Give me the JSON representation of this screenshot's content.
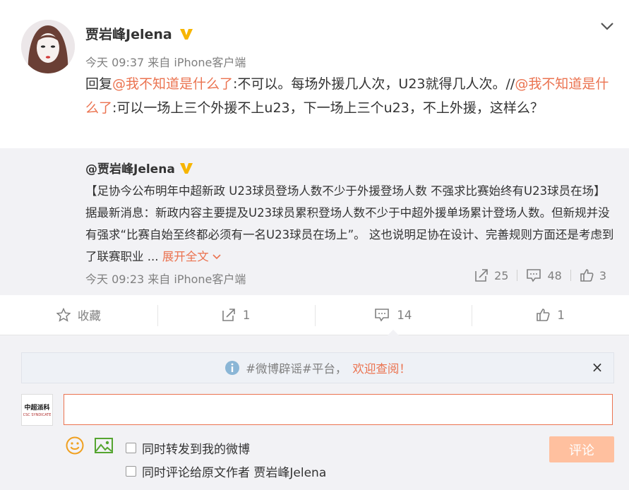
{
  "post": {
    "author": "贾岩峰Jelena",
    "meta": "今天 09:37 来自 iPhone客户端",
    "text": {
      "p1": "回复",
      "m1": "@我不知道是什么了",
      "p2": ":不可以。每场外援几人次，U23就得几人次。//",
      "m2": "@我不知道是什么了",
      "p3": ":可以一场上三个外援不上u23，下一场上三个u23，不上外援，这样么？"
    }
  },
  "repost": {
    "author": "@贾岩峰Jelena",
    "text": "【足协今公布明年中超新政 U23球员登场人数不少于外援登场人数 不强求比赛始终有U23球员在场】据最新消息：新政内容主要提及U23球员累积登场人数不少于中超外援单场累计登场人数。但新规并没有强求“比赛自始至终都必须有一名U23球员在场上”。 这也说明足协在设计、完善规则方面还是考虑到了联赛职业 ...",
    "more": "展开全文",
    "meta": "今天 09:23 来自 iPhone客户端",
    "forwards": "25",
    "comments": "48",
    "likes": "3"
  },
  "actions": {
    "favorite": "收藏",
    "forward": "1",
    "comment": "14",
    "like": "1"
  },
  "notice": {
    "text": "#微博辟谣#平台，",
    "link": "欢迎查阅！",
    "close": "×"
  },
  "logo": {
    "main": "中超派科",
    "sub": "CSC  SYNDICATE"
  },
  "comment": {
    "value": "",
    "option1": "同时转发到我的微博",
    "option2": "同时评论给原文作者 贾岩峰Jelena",
    "submit": "评论"
  },
  "colors": {
    "accent": "#eb7350",
    "verified": "#f7b500",
    "muted": "#808080",
    "panel": "#f2f2f5",
    "submit_disabled": "#ffc09f"
  }
}
